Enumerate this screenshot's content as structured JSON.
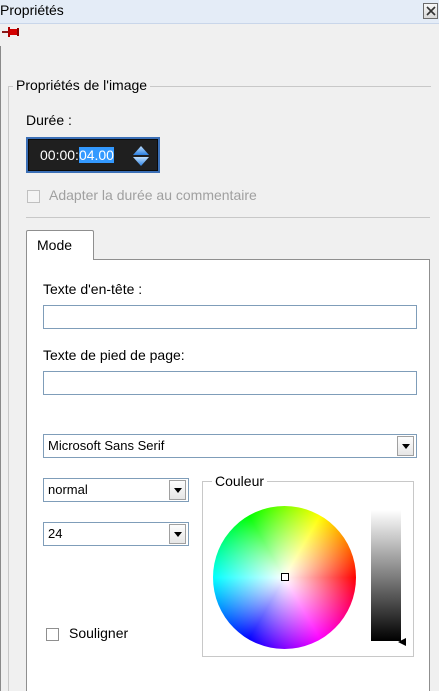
{
  "window": {
    "title": "Propriétés"
  },
  "group": {
    "title": "Propriétés de l'image"
  },
  "duration": {
    "label": "Durée :",
    "value_prefix": "00:00:",
    "value_selected": "04.00"
  },
  "adapt_duration": {
    "label": "Adapter la durée au commentaire",
    "checked": false,
    "enabled": false
  },
  "tabs": [
    {
      "label": "Mode"
    }
  ],
  "fields": {
    "header_label": "Texte d'en-tête :",
    "header_value": "",
    "footer_label": "Texte de pied de page:",
    "footer_value": ""
  },
  "font": {
    "family": "Microsoft Sans Serif",
    "style": "normal",
    "size": "24"
  },
  "underline": {
    "label": "Souligner",
    "checked": false
  },
  "color": {
    "title": "Couleur"
  },
  "icons": {
    "pin": "pushpin-icon",
    "close": "close-icon",
    "spin": "spin-updown-icon",
    "dropdown": "chevron-down-icon"
  },
  "colors": {
    "duration_bg": "#1f1f1f",
    "duration_selection": "#3399ff",
    "pin": "#cc0000"
  }
}
